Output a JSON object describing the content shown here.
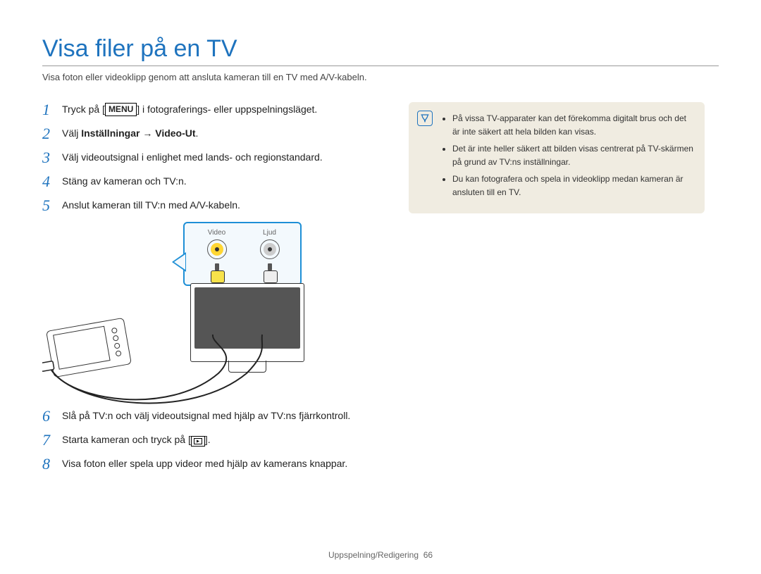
{
  "title": "Visa filer på en TV",
  "lead": "Visa foton eller videoklipp genom att ansluta kameran till en TV med A/V-kabeln.",
  "menu_key": "MENU",
  "steps": {
    "s1": {
      "pre": "Tryck på [",
      "post": "] i fotograferings- eller uppspelningsläget."
    },
    "s2": {
      "pre": "Välj ",
      "bold": "Inställningar → Video-Ut",
      "post": "."
    },
    "s3": "Välj videoutsignal i enlighet med lands- och regionstandard.",
    "s4": "Stäng av kameran och TV:n.",
    "s5": "Anslut kameran till TV:n med A/V-kabeln.",
    "s6": "Slå på TV:n och välj videoutsignal med hjälp av TV:ns fjärrkontroll.",
    "s7": {
      "pre": "Starta kameran och tryck på [",
      "post": "]."
    },
    "s8": "Visa foton eller spela upp videor med hjälp av kamerans knappar."
  },
  "callout": {
    "video": "Video",
    "audio": "Ljud"
  },
  "notes": [
    "På vissa TV-apparater kan det förekomma digitalt brus och det är inte säkert att hela bilden kan visas.",
    "Det är inte heller säkert att bilden visas centrerat på TV-skärmen på grund av TV:ns inställningar.",
    "Du kan fotografera och spela in videoklipp medan kameran är ansluten till en TV."
  ],
  "footer": {
    "section": "Uppspelning/Redigering",
    "page": "66"
  }
}
